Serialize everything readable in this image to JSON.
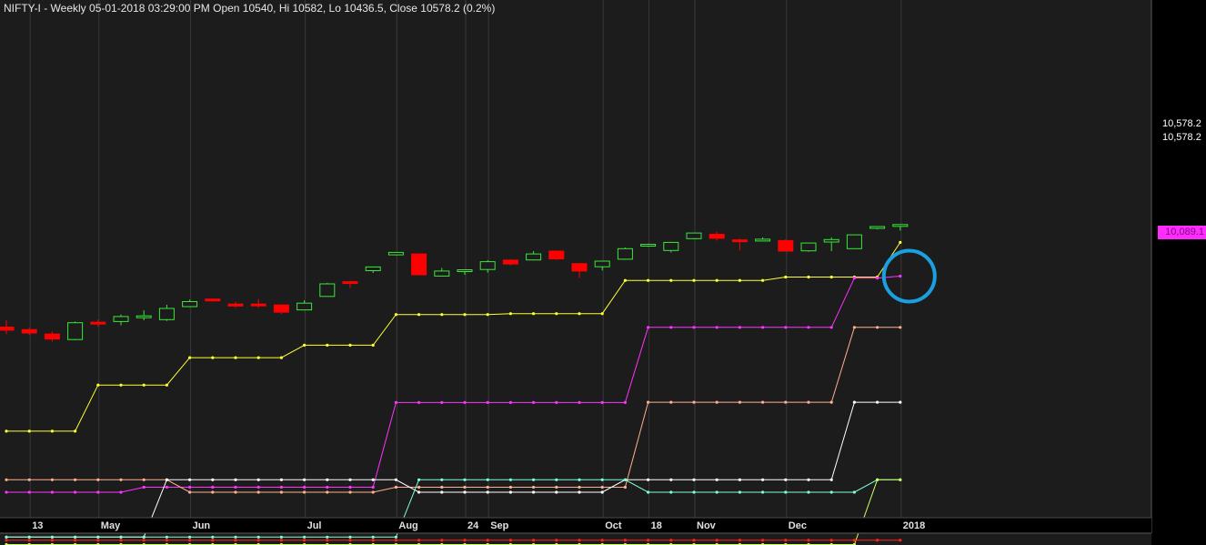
{
  "header": {
    "symbol": "NIFTY-I",
    "period": "Weekly",
    "datetime": "05-01-2018 03:29:00 PM",
    "summary_text": "NIFTY-I - Weekly 05-01-2018 03:29:00 PM Open 10540, Hi 10582, Lo 10436.5, Close 10578.2 (0.2%)"
  },
  "price_labels": {
    "last_close_1": "10,578.2",
    "last_close_2": "10,578.2",
    "magenta_tag": "10,089.1"
  },
  "x_axis_labels": [
    {
      "text": "13",
      "week": 1
    },
    {
      "text": "May",
      "week": 4
    },
    {
      "text": "Jun",
      "week": 8
    },
    {
      "text": "Jul",
      "week": 13
    },
    {
      "text": "Aug",
      "week": 17
    },
    {
      "text": "24",
      "week": 20
    },
    {
      "text": "Sep",
      "week": 21
    },
    {
      "text": "Oct",
      "week": 26
    },
    {
      "text": "18",
      "week": 28
    },
    {
      "text": "Nov",
      "week": 30
    },
    {
      "text": "Dec",
      "week": 34
    },
    {
      "text": "2018",
      "week": 39
    }
  ],
  "colors": {
    "background": "#1c1c1c",
    "up_candle": "#39e639",
    "down_candle": "#ff0000",
    "yellow_line": "#ffff33",
    "magenta_line": "#ff33ff",
    "salmon_line": "#ffb090",
    "white_line": "#ffffff",
    "cyan_line": "#7fffd4",
    "highlight_circle": "#1aa0e0"
  },
  "chart_data": {
    "type": "candlestick",
    "title": "NIFTY-I - Weekly",
    "y_range": [
      9000,
      10800
    ],
    "candles": [
      {
        "o": 9165,
        "h": 9220,
        "l": 9110,
        "c": 9140
      },
      {
        "o": 9145,
        "h": 9160,
        "l": 9100,
        "c": 9118
      },
      {
        "o": 9110,
        "h": 9130,
        "l": 9050,
        "c": 9070
      },
      {
        "o": 9065,
        "h": 9210,
        "l": 9060,
        "c": 9200
      },
      {
        "o": 9205,
        "h": 9225,
        "l": 9170,
        "c": 9190
      },
      {
        "o": 9210,
        "h": 9265,
        "l": 9180,
        "c": 9250
      },
      {
        "o": 9255,
        "h": 9300,
        "l": 9220,
        "c": 9255
      },
      {
        "o": 9225,
        "h": 9345,
        "l": 9215,
        "c": 9315
      },
      {
        "o": 9330,
        "h": 9385,
        "l": 9325,
        "c": 9370
      },
      {
        "o": 9390,
        "h": 9395,
        "l": 9370,
        "c": 9385
      },
      {
        "o": 9350,
        "h": 9370,
        "l": 9320,
        "c": 9335
      },
      {
        "o": 9350,
        "h": 9390,
        "l": 9320,
        "c": 9340
      },
      {
        "o": 9343,
        "h": 9345,
        "l": 9270,
        "c": 9285
      },
      {
        "o": 9303,
        "h": 9380,
        "l": 9300,
        "c": 9357
      },
      {
        "o": 9411,
        "h": 9520,
        "l": 9410,
        "c": 9512
      },
      {
        "o": 9530,
        "h": 9536,
        "l": 9477,
        "c": 9520
      },
      {
        "o": 9618,
        "h": 9650,
        "l": 9600,
        "c": 9648
      },
      {
        "o": 9745,
        "h": 9768,
        "l": 9740,
        "c": 9765
      },
      {
        "o": 9752,
        "h": 9755,
        "l": 9583,
        "c": 9585
      },
      {
        "o": 9575,
        "h": 9640,
        "l": 9575,
        "c": 9615
      },
      {
        "o": 9622,
        "h": 9630,
        "l": 9585,
        "c": 9625
      },
      {
        "o": 9627,
        "h": 9703,
        "l": 9602,
        "c": 9690
      },
      {
        "o": 9703,
        "h": 9710,
        "l": 9660,
        "c": 9672
      },
      {
        "o": 9704,
        "h": 9775,
        "l": 9700,
        "c": 9752
      },
      {
        "o": 9775,
        "h": 9781,
        "l": 9705,
        "c": 9713
      },
      {
        "o": 9675,
        "h": 9680,
        "l": 9560,
        "c": 9615
      },
      {
        "o": 9650,
        "h": 9695,
        "l": 9620,
        "c": 9695
      },
      {
        "o": 9710,
        "h": 9805,
        "l": 9705,
        "c": 9795
      },
      {
        "o": 9820,
        "h": 9835,
        "l": 9810,
        "c": 9830
      },
      {
        "o": 9780,
        "h": 9850,
        "l": 9765,
        "c": 9845
      },
      {
        "o": 9875,
        "h": 9920,
        "l": 9870,
        "c": 9920
      },
      {
        "o": 9910,
        "h": 9930,
        "l": 9860,
        "c": 9878
      },
      {
        "o": 9865,
        "h": 9875,
        "l": 9780,
        "c": 9852
      },
      {
        "o": 9870,
        "h": 9885,
        "l": 9867,
        "c": 9871
      },
      {
        "o": 9860,
        "h": 9870,
        "l": 9773,
        "c": 9775
      },
      {
        "o": 9777,
        "h": 9840,
        "l": 9769,
        "c": 9840
      },
      {
        "o": 9848,
        "h": 9885,
        "l": 9775,
        "c": 9868
      },
      {
        "o": 9795,
        "h": 9906,
        "l": 9795,
        "c": 9906
      },
      {
        "o": 9963,
        "h": 9974,
        "l": 9950,
        "c": 9972
      },
      {
        "o": 9982,
        "h": 9988,
        "l": 9940,
        "c": 9988
      }
    ],
    "series": [
      {
        "color": "#ffff33",
        "values": [
          8330,
          8330,
          8330,
          8330,
          8700,
          8700,
          8700,
          8700,
          8920,
          8920,
          8920,
          8920,
          8920,
          9020,
          9020,
          9020,
          9020,
          9266,
          9266,
          9266,
          9266,
          9266,
          9273,
          9273,
          9273,
          9273,
          9273,
          9540,
          9540,
          9540,
          9540,
          9540,
          9540,
          9540,
          9567,
          9567,
          9567,
          9567,
          9567,
          9845
        ]
      },
      {
        "color": "#ff33ff",
        "values": [
          7840,
          7840,
          7840,
          7840,
          7840,
          7840,
          7880,
          7880,
          7880,
          7880,
          7880,
          7880,
          7880,
          7880,
          7880,
          7880,
          7880,
          8560,
          8560,
          8560,
          8560,
          8560,
          8560,
          8560,
          8560,
          8560,
          8560,
          8560,
          9163,
          9163,
          9163,
          9163,
          9163,
          9163,
          9163,
          9163,
          9163,
          9559,
          9559,
          9574
        ]
      },
      {
        "color": "#ffb090",
        "values": [
          7940,
          7940,
          7940,
          7940,
          7940,
          7940,
          7940,
          7940,
          7840,
          7840,
          7840,
          7840,
          7840,
          7840,
          7840,
          7840,
          7840,
          7880,
          7880,
          7880,
          7880,
          7880,
          7880,
          7880,
          7880,
          7880,
          7880,
          7880,
          8562,
          8562,
          8562,
          8562,
          8562,
          8562,
          8562,
          8562,
          8562,
          9163,
          9163,
          9163
        ]
      },
      {
        "color": "#ffffff",
        "values": [
          7480,
          7480,
          7480,
          7480,
          7480,
          7480,
          7480,
          7940,
          7940,
          7940,
          7940,
          7940,
          7940,
          7940,
          7940,
          7940,
          7940,
          7940,
          7840,
          7840,
          7840,
          7840,
          7840,
          7840,
          7840,
          7840,
          7840,
          7940,
          7940,
          7940,
          7940,
          7940,
          7940,
          7940,
          7940,
          7940,
          7940,
          8562,
          8562,
          8562
        ]
      },
      {
        "color": "#7fffd4",
        "values": [
          7480,
          7480,
          7480,
          7480,
          7480,
          7480,
          7480,
          7480,
          7480,
          7480,
          7480,
          7480,
          7480,
          7480,
          7480,
          7480,
          7480,
          7480,
          7940,
          7940,
          7940,
          7940,
          7940,
          7940,
          7940,
          7940,
          7940,
          7940,
          7840,
          7840,
          7840,
          7840,
          7840,
          7840,
          7840,
          7840,
          7840,
          7840,
          7940,
          7940
        ]
      },
      {
        "color": "#ccff66",
        "values": [
          7420,
          7420,
          7420,
          7420,
          7420,
          7420,
          7420,
          7420,
          7420,
          7420,
          7420,
          7420,
          7420,
          7420,
          7420,
          7420,
          7420,
          7420,
          7420,
          7420,
          7420,
          7420,
          7420,
          7420,
          7420,
          7420,
          7420,
          7420,
          7420,
          7420,
          7420,
          7420,
          7420,
          7420,
          7420,
          7420,
          7420,
          7420,
          7940,
          7940
        ]
      },
      {
        "color": "#ff2020",
        "values": [
          7455,
          7455,
          7455,
          7455,
          7455,
          7455,
          7455,
          7455,
          7455,
          7455,
          7455,
          7455,
          7455,
          7455,
          7455,
          7455,
          7455,
          7455,
          7455,
          7455,
          7455,
          7455,
          7455,
          7455,
          7455,
          7455,
          7455,
          7455,
          7455,
          7455,
          7455,
          7455,
          7455,
          7455,
          7455,
          7455,
          7455,
          7455,
          7455,
          7455
        ]
      }
    ]
  }
}
